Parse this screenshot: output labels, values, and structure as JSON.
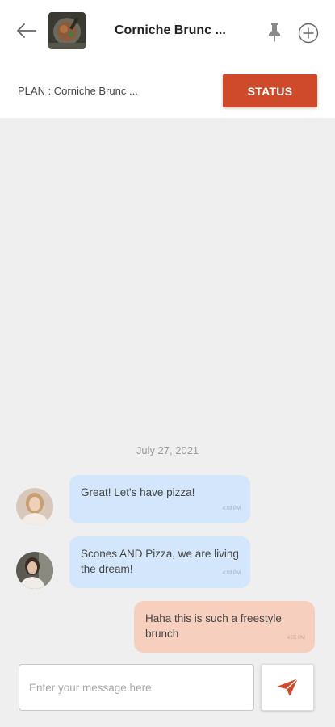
{
  "header": {
    "title": "Corniche Brunc ...",
    "icons": {
      "back": "back-arrow-icon",
      "pin": "pin-icon",
      "add": "add-circle-icon"
    }
  },
  "plan_bar": {
    "plan_label": "PLAN : Corniche Brunc ...",
    "status_label": "STATUS"
  },
  "chat": {
    "date": "July 27, 2021",
    "messages": [
      {
        "direction": "incoming",
        "text": "Great! Let's have pizza!",
        "time": "4:03 PM"
      },
      {
        "direction": "incoming",
        "text": "Scones AND Pizza, we are living the dream!",
        "time": "4:03 PM"
      },
      {
        "direction": "outgoing",
        "text": "Haha this is such a freestyle brunch",
        "time": "4:05 PM"
      }
    ]
  },
  "composer": {
    "placeholder": "Enter your message here",
    "value": ""
  },
  "colors": {
    "accent": "#cf4a2a",
    "incoming_bubble": "#d3e6fb",
    "outgoing_bubble": "#f7cfbf",
    "background": "#efefef"
  }
}
